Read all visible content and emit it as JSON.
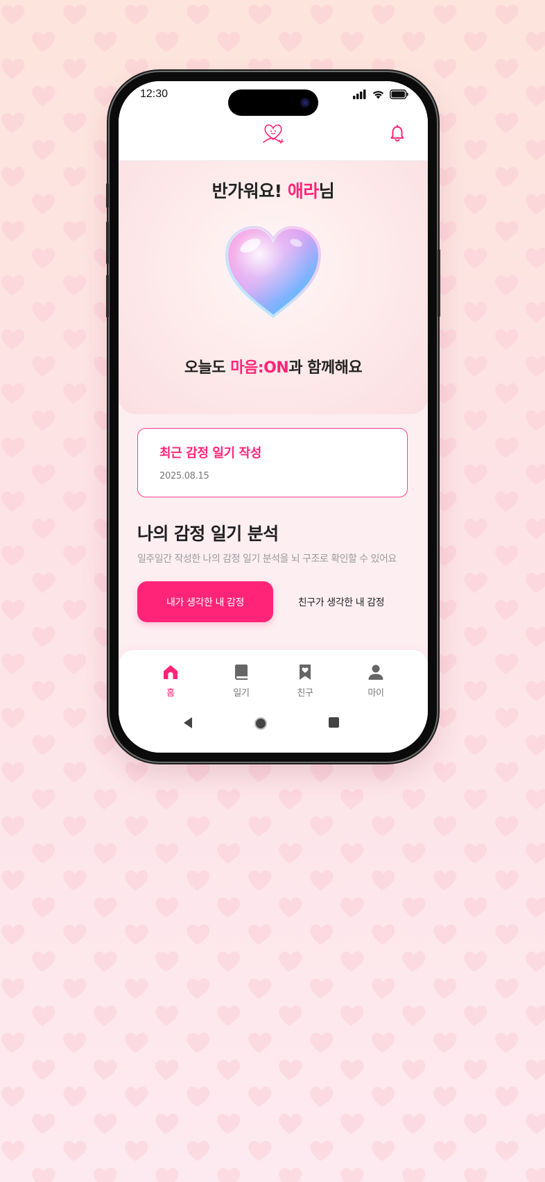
{
  "status_bar": {
    "time": "12:30"
  },
  "header": {
    "logo_icon": "heart-scribble-logo-icon",
    "bell_icon": "bell-icon"
  },
  "hero": {
    "greeting_prefix": "반가워요! ",
    "user_name": "애라",
    "greeting_suffix": "님",
    "tagline_prefix": "오늘도 ",
    "brand": "마음:ON",
    "tagline_suffix": "과 함께해요"
  },
  "recent_card": {
    "title": "최근 감정 일기 작성",
    "date": "2025.08.15"
  },
  "analysis": {
    "title": "나의 감정 일기 분석",
    "description": "일주일간 작성한 나의 감정 일기 분석을 뇌 구조로 확인할 수 있어요",
    "button_mine": "내가 생각한 내 감정",
    "button_friends": "친구가 생각한 내 감정"
  },
  "bottom_nav": {
    "items": [
      {
        "label": "홈",
        "icon": "home-icon",
        "active": true
      },
      {
        "label": "일기",
        "icon": "book-icon",
        "active": false
      },
      {
        "label": "친구",
        "icon": "heart-bookmark-icon",
        "active": false
      },
      {
        "label": "마이",
        "icon": "person-icon",
        "active": false
      }
    ]
  },
  "colors": {
    "accent": "#ff2477",
    "inactive": "#777777",
    "text": "#222222",
    "background": "#fde4e6"
  }
}
